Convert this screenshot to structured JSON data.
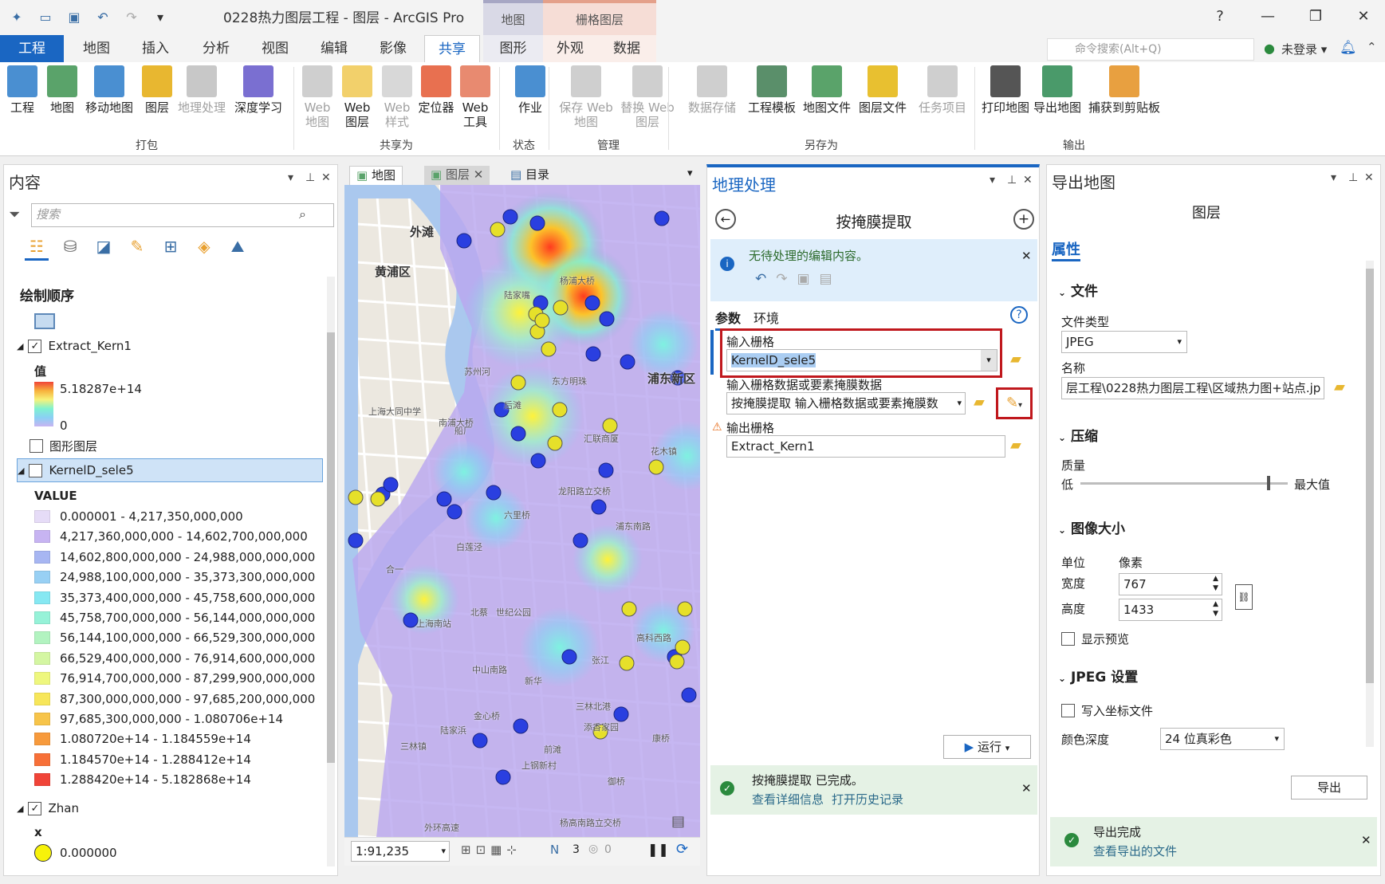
{
  "app": {
    "title": "0228热力图层工程 - 图层 - ArcGIS Pro"
  },
  "context_tabs": {
    "map_group": "地图",
    "raster_group": "栅格图层"
  },
  "tabs": [
    "工程",
    "地图",
    "插入",
    "分析",
    "视图",
    "编辑",
    "影像",
    "共享",
    "图形",
    "外观",
    "数据"
  ],
  "command_search": {
    "placeholder": "命令搜索(Alt+Q)"
  },
  "user": {
    "label": "未登录"
  },
  "ribbon": {
    "buttons": [
      {
        "label": "工程",
        "disabled": false,
        "color": "#4a8fd1"
      },
      {
        "label": "地图",
        "disabled": false,
        "color": "#5aa36a"
      },
      {
        "label": "移动地图",
        "disabled": false,
        "color": "#4a8fd1"
      },
      {
        "label": "图层",
        "disabled": false,
        "color": "#e8b730"
      },
      {
        "label": "地理处理",
        "disabled": true,
        "color": "#c8c8c8"
      },
      {
        "label": "深度学习",
        "disabled": false,
        "color": "#7a6fd1"
      },
      {
        "label": "Web 地图",
        "disabled": true,
        "color": "#cfcfcf"
      },
      {
        "label": "Web 图层",
        "disabled": false,
        "color": "#f2d06b"
      },
      {
        "label": "Web 样式",
        "disabled": true,
        "color": "#d8d8d8"
      },
      {
        "label": "定位器",
        "disabled": false,
        "color": "#e87050"
      },
      {
        "label": "Web 工具",
        "disabled": false,
        "color": "#e88a70"
      },
      {
        "label": "作业",
        "disabled": false,
        "color": "#4a8fd1"
      },
      {
        "label": "保存 Web 地图",
        "disabled": true,
        "color": "#cfcfcf"
      },
      {
        "label": "替换 Web 图层",
        "disabled": true,
        "color": "#cfcfcf"
      },
      {
        "label": "数据存储",
        "disabled": true,
        "color": "#cfcfcf"
      },
      {
        "label": "工程模板",
        "disabled": false,
        "color": "#5a8f6a"
      },
      {
        "label": "地图文件",
        "disabled": false,
        "color": "#5aa36a"
      },
      {
        "label": "图层文件",
        "disabled": false,
        "color": "#e8c030"
      },
      {
        "label": "任务项目",
        "disabled": true,
        "color": "#cfcfcf"
      },
      {
        "label": "打印地图",
        "disabled": false,
        "color": "#555555"
      },
      {
        "label": "导出地图",
        "disabled": false,
        "color": "#4a9a6a"
      },
      {
        "label": "捕获到剪贴板",
        "disabled": false,
        "color": "#e8a040"
      }
    ],
    "groups": [
      "打包",
      "共享为",
      "状态",
      "管理",
      "另存为",
      "输出"
    ]
  },
  "contents": {
    "title": "内容",
    "search_placeholder": "搜索",
    "draw_order": "绘制顺序",
    "layer1": {
      "name": "Extract_Kern1",
      "checked": true,
      "value_label": "值",
      "max": "5.18287e+14",
      "min": "0"
    },
    "graphics_layer": "图形图层",
    "layer2": {
      "name": "KernelD_sele5",
      "checked": false,
      "field": "VALUE"
    },
    "classes": [
      {
        "label": "0.000001 - 4,217,350,000,000",
        "color": "#e6dcf7"
      },
      {
        "label": "4,217,360,000,000 - 14,602,700,000,000",
        "color": "#c7b4f2"
      },
      {
        "label": "14,602,800,000,000 - 24,988,000,000,000",
        "color": "#a7b6f2"
      },
      {
        "label": "24,988,100,000,000 - 35,373,300,000,000",
        "color": "#98d0f4"
      },
      {
        "label": "35,373,400,000,000 - 45,758,600,000,000",
        "color": "#86e8f2"
      },
      {
        "label": "45,758,700,000,000 - 56,144,000,000,000",
        "color": "#96f2d8"
      },
      {
        "label": "56,144,100,000,000 - 66,529,300,000,000",
        "color": "#b2f3c0"
      },
      {
        "label": "66,529,400,000,000 - 76,914,600,000,000",
        "color": "#d4f6a2"
      },
      {
        "label": "76,914,700,000,000 - 87,299,900,000,000",
        "color": "#eef77e"
      },
      {
        "label": "87,300,000,000,000 - 97,685,200,000,000",
        "color": "#f7e65a"
      },
      {
        "label": "97,685,300,000,000 - 1.080706e+14",
        "color": "#f7c44a"
      },
      {
        "label": "1.080720e+14 - 1.184559e+14",
        "color": "#f79a3c"
      },
      {
        "label": "1.184570e+14 - 1.288412e+14",
        "color": "#f77038"
      },
      {
        "label": "1.288420e+14 - 5.182868e+14",
        "color": "#f04438"
      }
    ],
    "layer3": {
      "name": "Zhan",
      "checked": true,
      "field": "x",
      "class_value": "0.000000"
    }
  },
  "view_tabs": [
    "地图",
    "图层",
    "目录"
  ],
  "map": {
    "scale": "1:91,235",
    "selection_count": "3",
    "selected_count": "0",
    "labels": [
      "黄浦区",
      "外滩",
      "浦东新区",
      "南浦大桥",
      "龙阳路立交桥",
      "六里桥",
      "上海大同中学",
      "外环高速",
      "杨高南路立交桥",
      "三林镇",
      "康桥",
      "杨浦大桥",
      "后滩",
      "花木镇",
      "世纪公园",
      "合一",
      "北蔡",
      "张江",
      "三林北港",
      "添香家园",
      "金心桥",
      "御桥",
      "白莲泾",
      "上海南站",
      "汇联商厦",
      "陆家嘴",
      "东方明珠",
      "苏州河",
      "船厂",
      "新华",
      "陆家浜",
      "中山南路",
      "浦东南路",
      "前滩",
      "高科西路",
      "上钢新村"
    ]
  },
  "geoprocessing": {
    "title": "地理处理",
    "tool": "按掩膜提取",
    "notice": "无待处理的编辑内容。",
    "tab_params": "参数",
    "tab_env": "环境",
    "input_raster_label": "输入栅格",
    "input_raster_value": "KernelD_sele5",
    "mask_label": "输入栅格数据或要素掩膜数据",
    "mask_value": "按掩膜提取 输入栅格数据或要素掩膜数",
    "output_label": "输出栅格",
    "output_value": "Extract_Kern1",
    "run": "运行",
    "status_title": "按掩膜提取 已完成。",
    "status_link1": "查看详细信息",
    "status_link2": "打开历史记录",
    "accent": "#1a66c2",
    "highlight": "#c0181d"
  },
  "export": {
    "title": "导出地图",
    "subtitle": "图层",
    "properties": "属性",
    "file_section": "文件",
    "file_type_label": "文件类型",
    "file_type": "JPEG",
    "name_label": "名称",
    "name_value": "层工程\\0228热力图层工程\\区域热力图+站点.jp",
    "compression": "压缩",
    "quality": "质量",
    "quality_low": "低",
    "quality_high": "最大值",
    "quality_level": 0.9,
    "image_size": "图像大小",
    "unit_label": "单位",
    "unit_value": "像素",
    "width_label": "宽度",
    "width_value": "767",
    "height_label": "高度",
    "height_value": "1433",
    "preview": "显示预览",
    "jpeg_settings": "JPEG 设置",
    "world_file": "写入坐标文件",
    "color_depth_label": "颜色深度",
    "color_depth": "24 位真彩色",
    "export_button": "导出",
    "status_title": "导出完成",
    "status_link": "查看导出的文件"
  }
}
